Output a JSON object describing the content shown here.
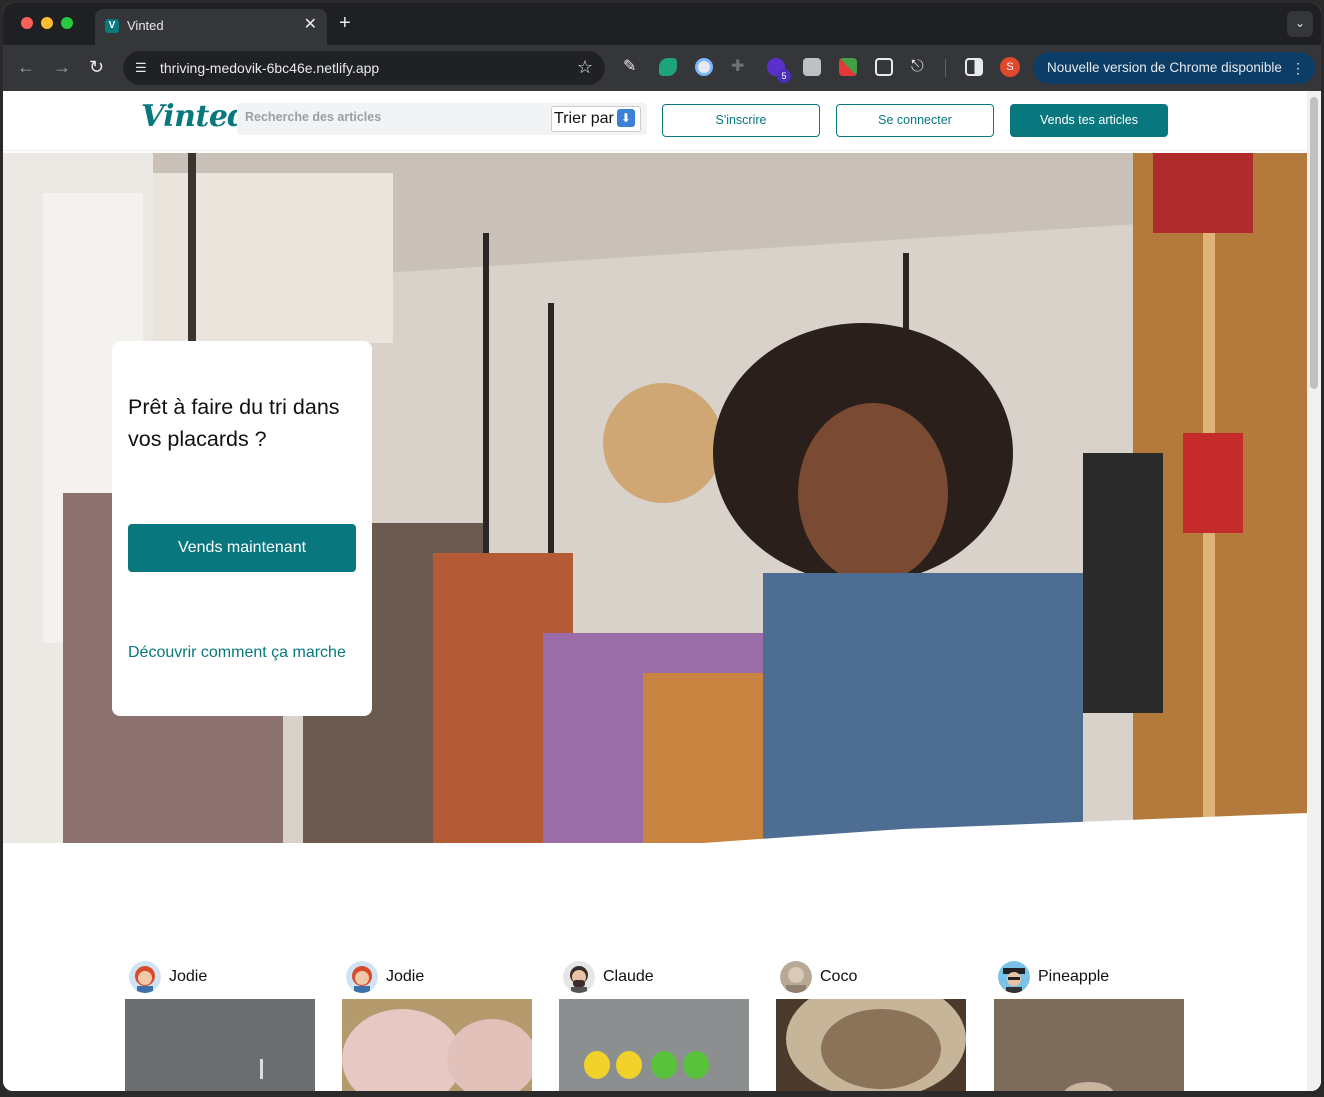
{
  "browser": {
    "tab_title": "Vinted",
    "tab_favicon_letter": "V",
    "tab_close": "✕",
    "new_tab": "+",
    "url": "thriving-medovik-6bc46e.netlify.app",
    "extension_badge": "5",
    "profile_initial": "S",
    "update_text": "Nouvelle version de Chrome disponible"
  },
  "header": {
    "logo": "Vinted",
    "search_placeholder": "Recherche des articles",
    "sort_label": "Trier par",
    "sort_icon": "⬇",
    "signup": "S'inscrire",
    "login": "Se connecter",
    "sell": "Vends tes articles"
  },
  "hero": {
    "title": "Prêt à faire du tri dans vos placards ?",
    "cta": "Vends maintenant",
    "link": "Découvrir comment ça marche"
  },
  "feed": {
    "items": [
      {
        "username": "Jodie",
        "avatar": "woman-red-hair-avatar"
      },
      {
        "username": "Jodie",
        "avatar": "woman-red-hair-avatar"
      },
      {
        "username": "Claude",
        "avatar": "man-beard-glasses-avatar"
      },
      {
        "username": "Coco",
        "avatar": "photo-avatar"
      },
      {
        "username": "Pineapple",
        "avatar": "man-hat-glasses-avatar"
      }
    ]
  },
  "colors": {
    "brand": "#09777e",
    "chrome_dark": "#35363a",
    "update_pill": "#0b3d66"
  }
}
